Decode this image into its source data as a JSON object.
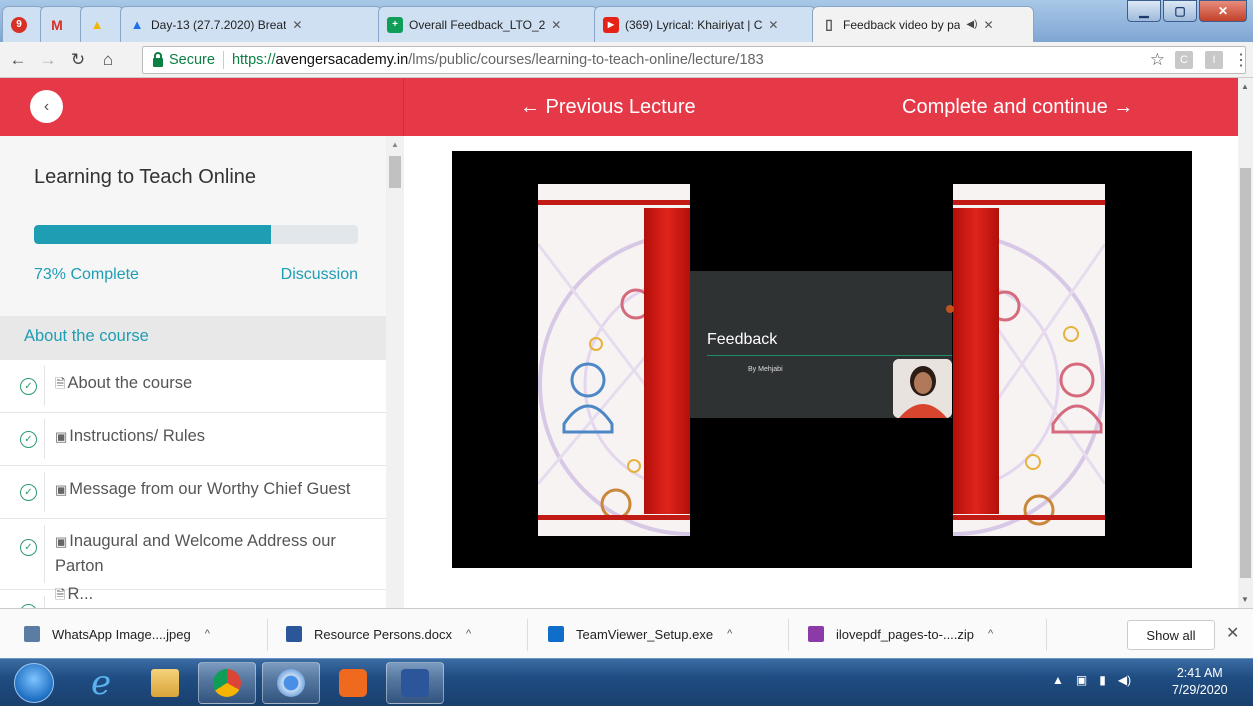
{
  "browser": {
    "tabs": [
      {
        "title": "",
        "favicon_color": "#d93025",
        "favicon_glyph": "9",
        "icon": "sheets-red-icon"
      },
      {
        "title": "",
        "favicon_color": "#ffffff",
        "favicon_glyph": "M",
        "icon": "gmail-icon"
      },
      {
        "title": "",
        "favicon_color": "#f4b400",
        "favicon_glyph": "▲",
        "icon": "drive-icon"
      },
      {
        "title": "Day-13 (27.7.2020) Breat",
        "favicon_color": "#1a73e8",
        "favicon_glyph": "▲",
        "icon": "drive-icon"
      },
      {
        "title": "Overall Feedback_LTO_2",
        "favicon_color": "#0f9d58",
        "favicon_glyph": "+",
        "icon": "forms-plus-icon"
      },
      {
        "title": "(369) Lyrical: Khairiyat | C",
        "favicon_color": "#e62117",
        "favicon_glyph": "▶",
        "icon": "youtube-icon"
      },
      {
        "title": "Feedback video by pa",
        "favicon_color": "#ffffff",
        "favicon_glyph": "▯",
        "icon": "page-icon",
        "active": true,
        "audio": "◀)"
      }
    ],
    "url": {
      "secure_label": "Secure",
      "scheme": "https://",
      "host": "avengersacademy.in",
      "path": "/lms/public/courses/learning-to-teach-online/lecture/183"
    }
  },
  "header": {
    "back_glyph": "‹",
    "prev_label": "← Previous Lecture",
    "next_label": "Complete and continue →"
  },
  "sidebar": {
    "course_title": "Learning to Teach Online",
    "progress_percent": 73,
    "progress_label": "73% Complete",
    "discussion_label": "Discussion",
    "section_title": "About the course",
    "lectures": [
      {
        "icon": "🗎",
        "title": "About the course"
      },
      {
        "icon": "▣",
        "title": "Instructions/ Rules"
      },
      {
        "icon": "▣",
        "title": "Message from our Worthy Chief Guest"
      },
      {
        "icon": "▣",
        "title": "Inaugural and Welcome Address our Parton"
      },
      {
        "icon": "🗎",
        "title": "R..."
      }
    ]
  },
  "video": {
    "slide_title": "Feedback",
    "slide_subtitle": "By Mehjabi"
  },
  "downloads": {
    "items": [
      {
        "name": "WhatsApp Image....jpeg",
        "icon_color": "#5b7ca3"
      },
      {
        "name": "Resource Persons.docx",
        "icon_color": "#2b579a"
      },
      {
        "name": "TeamViewer_Setup.exe",
        "icon_color": "#0e6ec9"
      },
      {
        "name": "ilovepdf_pages-to-....zip",
        "icon_color": "#8b3aa8"
      }
    ],
    "show_all_label": "Show all"
  },
  "taskbar": {
    "time": "2:41 AM",
    "date": "7/29/2020"
  },
  "colors": {
    "accent_red": "#e53948",
    "teal": "#1f9db3",
    "check_green": "#2d9a6e"
  }
}
